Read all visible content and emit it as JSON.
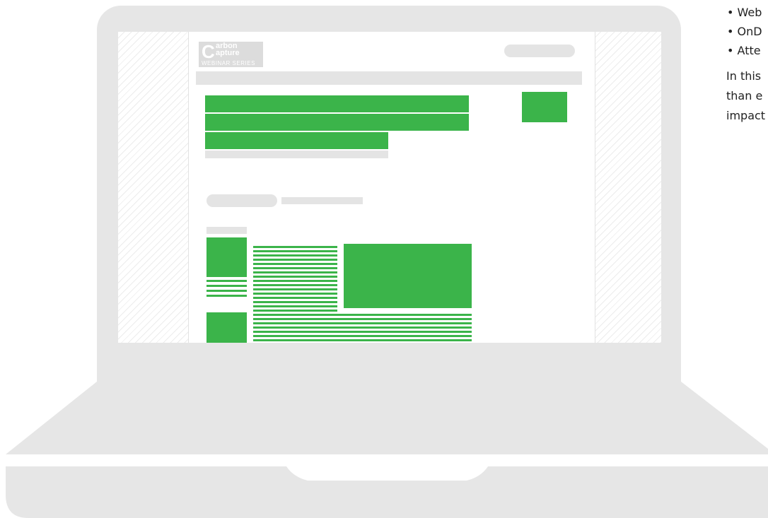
{
  "logo": {
    "line1": "arbon",
    "line2": "apture",
    "series": "WEBINAR SERIES"
  },
  "side_text": {
    "bullets": [
      "• Web",
      "• OnD",
      "• Atte"
    ],
    "paragraph": [
      "In this",
      "than e",
      "impact"
    ]
  },
  "colors": {
    "accent": "#3bb44a",
    "laptop": "#e6e6e6",
    "placeholder": "#e4e4e4"
  },
  "icons": [
    "laptop-icon"
  ]
}
